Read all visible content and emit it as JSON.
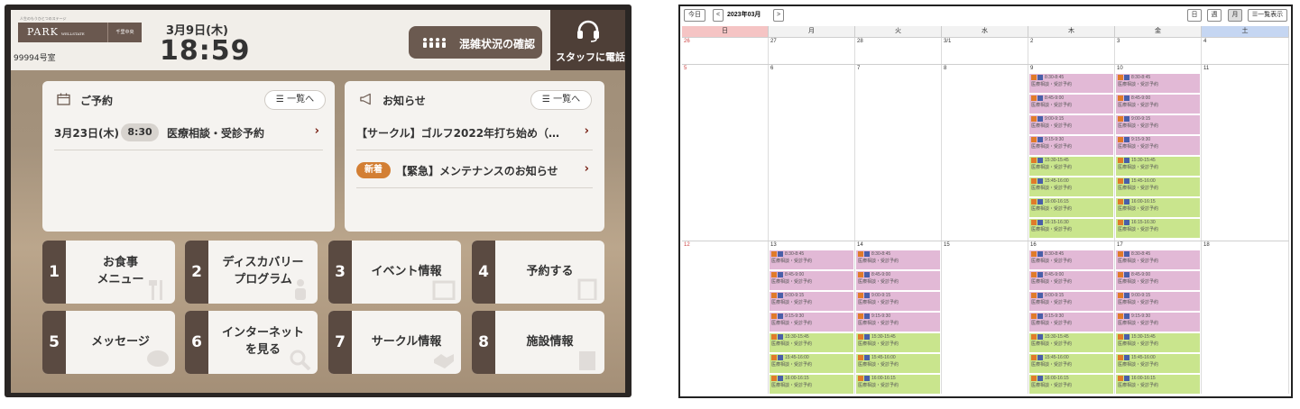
{
  "tablet": {
    "header": {
      "logo_tagline": "人生のもうひとつのステージ",
      "logo_main": "PARK",
      "logo_sub": "WELLSTATE",
      "logo_location": "千里中央",
      "room_number": "99994号室",
      "date": "3月9日(木)",
      "time": "18:59",
      "crowd_button": "混雑状況の確認",
      "call_button": "スタッフに電話"
    },
    "reservations": {
      "title": "ご予約",
      "list_button": "一覧へ",
      "items": [
        {
          "date": "3月23日(木)",
          "time": "8:30",
          "title": "医療相談・受診予約"
        }
      ]
    },
    "news": {
      "title": "お知らせ",
      "list_button": "一覧へ",
      "items": [
        {
          "text": "【サークル】ゴルフ2022年打ち始め（…",
          "badge": ""
        },
        {
          "text": "【緊急】メンテナンスのお知らせ",
          "badge": "新着"
        }
      ]
    },
    "menu": [
      {
        "num": "1",
        "label": "お食事\nメニュー",
        "icon": "utensils-icon"
      },
      {
        "num": "2",
        "label": "ディスカバリー\nプログラム",
        "icon": "person-icon"
      },
      {
        "num": "3",
        "label": "イベント情報",
        "icon": "calendar-icon"
      },
      {
        "num": "4",
        "label": "予約する",
        "icon": "clipboard-icon"
      },
      {
        "num": "5",
        "label": "メッセージ",
        "icon": "chat-icon"
      },
      {
        "num": "6",
        "label": "インターネット\nを見る",
        "icon": "magnifier-icon"
      },
      {
        "num": "7",
        "label": "サークル情報",
        "icon": "handshake-icon"
      },
      {
        "num": "8",
        "label": "施設情報",
        "icon": "building-icon"
      }
    ]
  },
  "calendar": {
    "today_button": "今日",
    "prev_button": "<",
    "title": "2023年03月",
    "next_button": ">",
    "view_day": "日",
    "view_week": "週",
    "view_month": "月",
    "list_view": "一覧表示",
    "weekdays": [
      "日",
      "月",
      "火",
      "水",
      "木",
      "金",
      "土"
    ],
    "weeks": [
      {
        "days": [
          "26",
          "27",
          "28",
          "3/1",
          "2",
          "3",
          "4"
        ],
        "events": [
          [],
          [],
          [],
          [],
          [],
          [],
          []
        ]
      },
      {
        "days": [
          "5",
          "6",
          "7",
          "8",
          "9",
          "10",
          "11"
        ],
        "events": [
          [],
          [],
          [],
          [],
          [
            {
              "time": "8:30-8:45",
              "title": "医療相談・受診予約",
              "color": "pink"
            },
            {
              "time": "8:45-9:00",
              "title": "医療相談・受診予約",
              "color": "pink"
            },
            {
              "time": "9:00-9:15",
              "title": "医療相談・受診予約",
              "color": "pink"
            },
            {
              "time": "9:15-9:30",
              "title": "医療相談・受診予約",
              "color": "pink"
            },
            {
              "time": "15:30-15:45",
              "title": "医療相談・受診予約",
              "color": "green"
            },
            {
              "time": "15:45-16:00",
              "title": "医療相談・受診予約",
              "color": "green"
            },
            {
              "time": "16:00-16:15",
              "title": "医療相談・受診予約",
              "color": "green"
            },
            {
              "time": "16:15-16:30",
              "title": "医療相談・受診予約",
              "color": "green"
            }
          ],
          [
            {
              "time": "8:30-8:45",
              "title": "医療相談・受診予約",
              "color": "pink"
            },
            {
              "time": "8:45-9:00",
              "title": "医療相談・受診予約",
              "color": "pink"
            },
            {
              "time": "9:00-9:15",
              "title": "医療相談・受診予約",
              "color": "pink"
            },
            {
              "time": "9:15-9:30",
              "title": "医療相談・受診予約",
              "color": "pink"
            },
            {
              "time": "15:30-15:45",
              "title": "医療相談・受診予約",
              "color": "green"
            },
            {
              "time": "15:45-16:00",
              "title": "医療相談・受診予約",
              "color": "green"
            },
            {
              "time": "16:00-16:15",
              "title": "医療相談・受診予約",
              "color": "green"
            },
            {
              "time": "16:15-16:30",
              "title": "医療相談・受診予約",
              "color": "green"
            }
          ],
          []
        ]
      },
      {
        "days": [
          "12",
          "13",
          "14",
          "15",
          "16",
          "17",
          "18"
        ],
        "events": [
          [],
          [
            {
              "time": "8:30-8:45",
              "title": "医療相談・受診予約",
              "color": "pink"
            },
            {
              "time": "8:45-9:00",
              "title": "医療相談・受診予約",
              "color": "pink"
            },
            {
              "time": "9:00-9:15",
              "title": "医療相談・受診予約",
              "color": "pink"
            },
            {
              "time": "9:15-9:30",
              "title": "医療相談・受診予約",
              "color": "pink"
            },
            {
              "time": "15:30-15:45",
              "title": "医療相談・受診予約",
              "color": "green"
            },
            {
              "time": "15:45-16:00",
              "title": "医療相談・受診予約",
              "color": "green"
            },
            {
              "time": "16:00-16:15",
              "title": "医療相談・受診予約",
              "color": "green"
            }
          ],
          [
            {
              "time": "8:30-8:45",
              "title": "医療相談・受診予約",
              "color": "pink"
            },
            {
              "time": "8:45-9:00",
              "title": "医療相談・受診予約",
              "color": "pink"
            },
            {
              "time": "9:00-9:15",
              "title": "医療相談・受診予約",
              "color": "pink"
            },
            {
              "time": "9:15-9:30",
              "title": "医療相談・受診予約",
              "color": "pink"
            },
            {
              "time": "15:30-15:45",
              "title": "医療相談・受診予約",
              "color": "green"
            },
            {
              "time": "15:45-16:00",
              "title": "医療相談・受診予約",
              "color": "green"
            },
            {
              "time": "16:00-16:15",
              "title": "医療相談・受診予約",
              "color": "green"
            }
          ],
          [],
          [
            {
              "time": "8:30-8:45",
              "title": "医療相談・受診予約",
              "color": "pink"
            },
            {
              "time": "8:45-9:00",
              "title": "医療相談・受診予約",
              "color": "pink"
            },
            {
              "time": "9:00-9:15",
              "title": "医療相談・受診予約",
              "color": "pink"
            },
            {
              "time": "9:15-9:30",
              "title": "医療相談・受診予約",
              "color": "pink"
            },
            {
              "time": "15:30-15:45",
              "title": "医療相談・受診予約",
              "color": "green"
            },
            {
              "time": "15:45-16:00",
              "title": "医療相談・受診予約",
              "color": "green"
            },
            {
              "time": "16:00-16:15",
              "title": "医療相談・受診予約",
              "color": "green"
            }
          ],
          [
            {
              "time": "8:30-8:45",
              "title": "医療相談・受診予約",
              "color": "pink"
            },
            {
              "time": "8:45-9:00",
              "title": "医療相談・受診予約",
              "color": "pink"
            },
            {
              "time": "9:00-9:15",
              "title": "医療相談・受診予約",
              "color": "pink"
            },
            {
              "time": "9:15-9:30",
              "title": "医療相談・受診予約",
              "color": "pink"
            },
            {
              "time": "15:30-15:45",
              "title": "医療相談・受診予約",
              "color": "green"
            },
            {
              "time": "15:45-16:00",
              "title": "医療相談・受診予約",
              "color": "green"
            },
            {
              "time": "16:00-16:15",
              "title": "医療相談・受診予約",
              "color": "green"
            }
          ],
          []
        ]
      }
    ]
  }
}
